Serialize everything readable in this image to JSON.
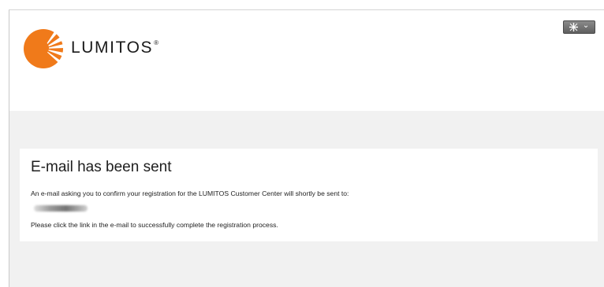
{
  "header": {
    "logo_text": "LUMITOS",
    "logo_mark": "®",
    "brand_color": "#f07a1a",
    "language_button": {
      "icon": "flag-icon",
      "caret": "⌄"
    }
  },
  "message": {
    "title": "E-mail has been sent",
    "confirm_text": "An e-mail asking you to confirm your registration for the LUMITOS Customer Center will shortly be sent to:",
    "instruction_text": "Please click the link in the e-mail to successfully complete the registration process."
  },
  "colors": {
    "page_background": "#f1f1f1",
    "panel_background": "#ffffff",
    "button_background": "#6e6e6e"
  }
}
